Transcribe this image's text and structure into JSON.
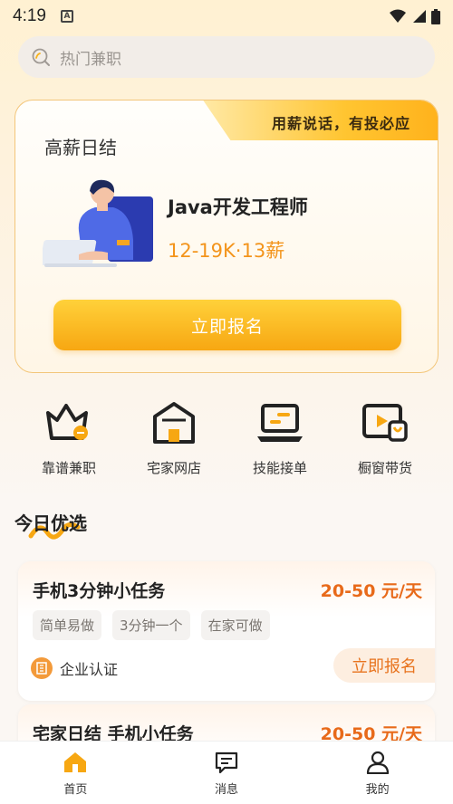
{
  "status_bar": {
    "time": "4:19",
    "notification_icon": "A"
  },
  "search": {
    "placeholder": "热门兼职"
  },
  "hero": {
    "title": "高薪日结",
    "ribbon": "用薪说话，有投必应",
    "job_title": "Java开发工程师",
    "salary": "12-19K·13薪",
    "apply_label": "立即报名"
  },
  "categories": [
    {
      "label": "靠谱兼职",
      "icon": "basket-icon"
    },
    {
      "label": "宅家网店",
      "icon": "shop-icon"
    },
    {
      "label": "技能接单",
      "icon": "laptop-icon"
    },
    {
      "label": "橱窗带货",
      "icon": "video-bag-icon"
    }
  ],
  "today": {
    "title": "今日优选",
    "jobs": [
      {
        "name": "手机3分钟小任务",
        "pay": "20-50 元/天",
        "tags": [
          "简单易做",
          "3分钟一个",
          "在家可做"
        ],
        "verify": "企业认证",
        "apply": "立即报名"
      },
      {
        "name": "宅家日结 手机小任务",
        "pay": "20-50 元/天"
      }
    ]
  },
  "tabbar": [
    {
      "label": "首页",
      "active": true
    },
    {
      "label": "消息",
      "active": false
    },
    {
      "label": "我的",
      "active": false
    }
  ],
  "colors": {
    "accent": "#f7a712",
    "price": "#e86a1a",
    "salary": "#f3941b"
  }
}
